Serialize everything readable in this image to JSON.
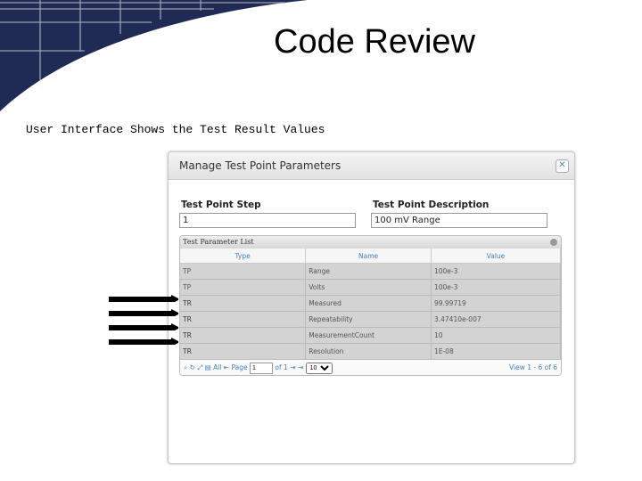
{
  "slide": {
    "title": "Code Review",
    "subtitle": "User Interface Shows the Test Result Values"
  },
  "colors": {
    "banner": "#1f2a55",
    "accent_link": "#4a7fb5"
  },
  "dialog": {
    "title": "Manage Test Point Parameters",
    "close_icon": "close-icon",
    "step_label": "Test Point Step",
    "step_value": "1",
    "desc_label": "Test Point Description",
    "desc_value": "100 mV Range",
    "grid": {
      "caption": "Test Parameter List",
      "columns": [
        "Type",
        "Name",
        "Value"
      ],
      "rows": [
        [
          "TP",
          "Range",
          "100e-3"
        ],
        [
          "TP",
          "Volts",
          "100e-3"
        ],
        [
          "TR",
          "Measured",
          "99.99719"
        ],
        [
          "TR",
          "Repeatability",
          "3.47410e-007"
        ],
        [
          "TR",
          "MeasurementCount",
          "10"
        ],
        [
          "TR",
          "Resolution",
          "1E-08"
        ]
      ],
      "pager": {
        "page_label": "Page",
        "page_value": "1",
        "of_label": "of 1",
        "page_size": "10",
        "view": "View 1 - 6 of 6"
      }
    }
  }
}
